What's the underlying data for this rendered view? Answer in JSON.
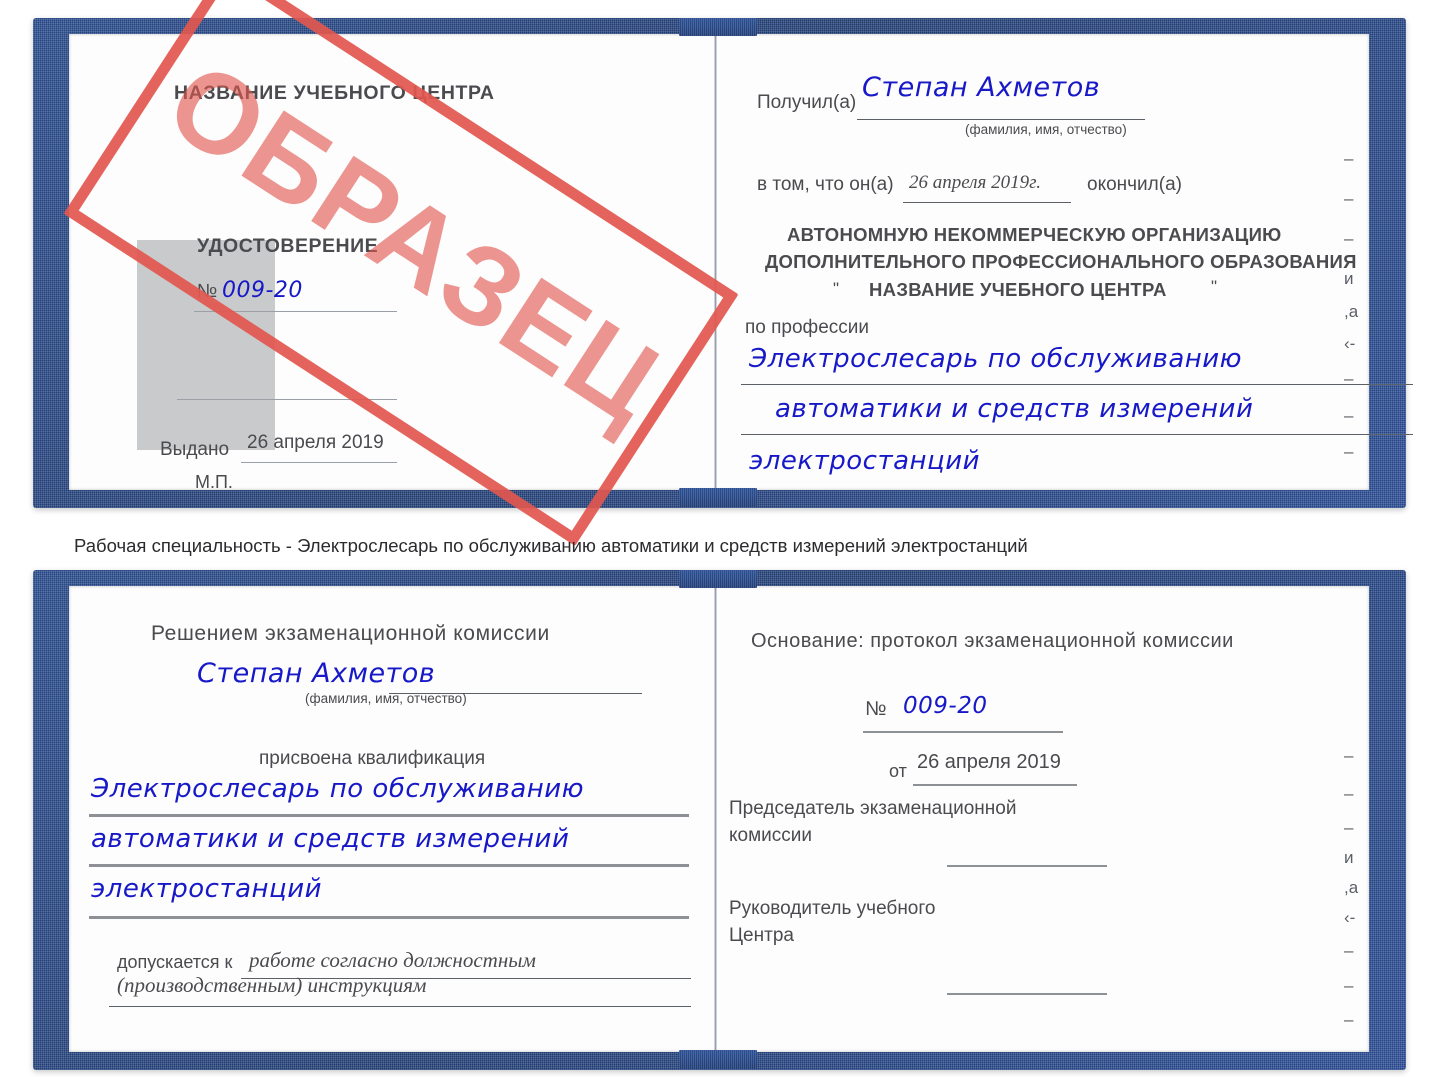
{
  "document": {
    "type": "Удостоверение",
    "watermark": "ОБРАЗЕЦ",
    "watermark_color": "#e2574f",
    "cover_color": "#2c4f92",
    "handwriting_color": "#1718c8"
  },
  "caption": {
    "text": "Рабочая специальность - Электрослесарь по обслуживанию автоматики и средств измерений электростанций"
  },
  "top_spread": {
    "left_page": {
      "center_name": "НАЗВАНИЕ УЧЕБНОГО ЦЕНТРА",
      "doc_title": "УДОСТОВЕРЕНИЕ",
      "number_label": "№",
      "number_value": "009-20",
      "issued_label": "Выдано",
      "issued_value": "26 апреля 2019",
      "stamp_label": "М.П."
    },
    "right_page": {
      "received_label": "Получил(а)",
      "received_value": "Степан Ахметов",
      "fio_hint": "(фамилия, имя, отчество)",
      "in_that_label": "в том, что он(а)",
      "completion_date": "26 апреля 2019г.",
      "finished_label": "окончил(а)",
      "org_line1": "АВТОНОМНУЮ НЕКОММЕРЧЕСКУЮ ОРГАНИЗАЦИЮ",
      "org_line2": "ДОПОЛНИТЕЛЬНОГО ПРОФЕССИОНАЛЬНОГО ОБРАЗОВАНИЯ",
      "org_quote_open": "\"",
      "org_line3": "НАЗВАНИЕ УЧЕБНОГО ЦЕНТРА",
      "org_quote_close": "\"",
      "profession_label": "по профессии",
      "profession_line1": "Электрослесарь по обслуживанию",
      "profession_line2": "автоматики и средств измерений",
      "profession_line3": "электростанций"
    },
    "edge_fragments": [
      "–",
      "–",
      "–",
      "–",
      "и",
      ",а",
      "‹-",
      "–",
      "–",
      "–"
    ]
  },
  "bottom_spread": {
    "left_page": {
      "heading": "Решением экзаменационной комиссии",
      "name_value": "Степан Ахметов",
      "fio_hint": "(фамилия, имя, отчество)",
      "qualification_label": "присвоена квалификация",
      "qualification_line1": "Электрослесарь по обслуживанию",
      "qualification_line2": "автоматики и средств измерений",
      "qualification_line3": "электростанций",
      "admitted_label": "допускается к",
      "admitted_value_line1": "работе согласно должностным",
      "admitted_value_line2": "(производственным) инструкциям"
    },
    "right_page": {
      "basis_label": "Основание: протокол экзаменационной комиссии",
      "protocol_number_label": "№",
      "protocol_number_value": "009-20",
      "protocol_date_label": "от",
      "protocol_date_value": "26 апреля 2019",
      "chairman_line1": "Председатель экзаменационной",
      "chairman_line2": "комиссии",
      "head_line1": "Руководитель учебного",
      "head_line2": "Центра"
    },
    "edge_fragments": [
      "–",
      "–",
      "–",
      "и",
      ",а",
      "‹-",
      "–",
      "–",
      "–",
      "–"
    ]
  }
}
